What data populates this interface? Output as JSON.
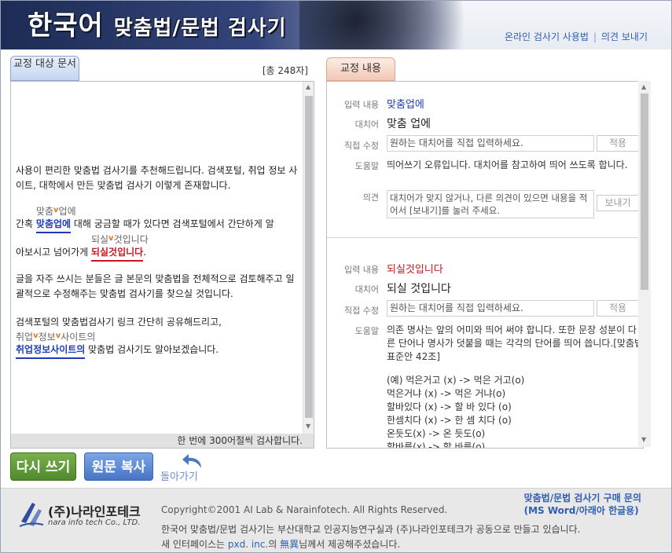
{
  "header": {
    "title_main": "한국어 ",
    "title_sub": "맞춤법/문법 검사기",
    "links": [
      "온라인 검사기 사용법",
      "의견 보내기"
    ]
  },
  "left_panel": {
    "tab_label": "교정 대상 문서",
    "char_count": "[총 248자]",
    "paragraphs": [
      "사용이 편리한 맞춤법 검사기를 추천해드립니다. 검색포털, 취업 정보 사이트, 대학에서 만든 맞춤법 검사기 이렇게 존재합니다.",
      "글을 자주 쓰시는 분들은 글 본문의 맞춤법을 전체적으로 검토해주고 일괄적으로 수정해주는 맞춤법 검사기를 찾으실 것입니다.",
      "검색포털의 맞춤법검사기 링크 간단히 공유해드리고,"
    ],
    "line2": {
      "pre": "간혹 ",
      "err_text": "맞춤업에",
      "sugg_a": "맞춤",
      "sugg_b": "업에",
      "post": " 대해 궁금할 때가 있다면 검색포털에서 간단하게 알"
    },
    "line3": {
      "pre": "아보시고 넘어가게 ",
      "err_text": "되실것입니다",
      "sugg_a": "되실",
      "sugg_b": "것입니다",
      "post": "."
    },
    "line4": {
      "err_text": "취업정보사이트의",
      "sugg_a": "취업",
      "sugg_b": "정보",
      "sugg_c": "사이트의",
      "post": " 맞춤법 검사기도 알아보겠습니다."
    },
    "footer_note": "한 번에 300어절씩 검사합니다."
  },
  "right_panel": {
    "tab_label": "교정 내용",
    "labels": {
      "input": "입력 내용",
      "alternative": "대치어",
      "direct_edit": "직접 수정",
      "help": "도움말",
      "opinion": "의견"
    },
    "entries": [
      {
        "input": "맞춤업에",
        "input_color": "#1d3cb8",
        "alternative": "맞춤 업에",
        "edit_placeholder": "원하는 대치어를 직접 입력하세요.",
        "apply_label": "적용",
        "help": "띄어쓰기 오류입니다. 대치어를 참고하여 띄어 쓰도록 합니다.",
        "opinion_placeholder": "대치어가 맞지 않거나, 다른 의견이 있으면 내용을 적어서 [보내기]를 눌러 주세요.",
        "send_label": "보내기"
      },
      {
        "input": "되실것입니다",
        "input_color": "#c9161f",
        "alternative": "되실 것입니다",
        "edit_placeholder": "원하는 대치어를 직접 입력하세요.",
        "apply_label": "적용",
        "help": "의존 명사는 앞의 어미와 띄어 써야 합니다. 또한 문장 성분이 다른 단어나 명사가 덧붙을 때는 각각의 단어를 띄어 씁니다.[맞춤법 표준안 42조]",
        "examples": [
          "(예) 먹은거고 (x) -> 먹은 거고(o)",
          "먹은거냐 (x) -> 먹은 거냐(o)",
          "할바있다 (x) -> 할 바 있다 (o)",
          "한셈치다 (x) -> 한 셈 치다 (o)",
          "온듯도(x) -> 온 듯도(o)",
          "할바를(x) -> 할 바를(o)"
        ]
      }
    ]
  },
  "actions": {
    "retry": "다시 쓰기",
    "copy": "원문 복사",
    "back": "돌아가기"
  },
  "footer": {
    "company": "(주)나라인포테크",
    "company_en": "nara info tech Co., LTD.",
    "copyright": "Copyright©2001 AI Lab & Narainfotech. All Rights Reserved.",
    "info_line1": "한국어 맞춤법/문법 검사기는 부산대학교 인공지능연구실과 (주)나라인포테크가 공동으로 만들고 있습니다.",
    "info_pre": "새 인터페이스는 ",
    "info_link": "pxd. inc.",
    "info_mid": "의 ",
    "info_name": "無異",
    "info_post": "님께서 제공해주셨습니다.",
    "buy_line1": "맞춤법/문법 검사기 구매 문의",
    "buy_line2": "(MS Word/아래아 한글용)"
  },
  "colors": {
    "header_dark": "#1d2c55",
    "error_blue": "#1d3cb8",
    "error_red": "#c9161f",
    "retry_green": "#5f9a38",
    "copy_blue": "#5887d4",
    "link_blue": "#2f5fb3"
  }
}
